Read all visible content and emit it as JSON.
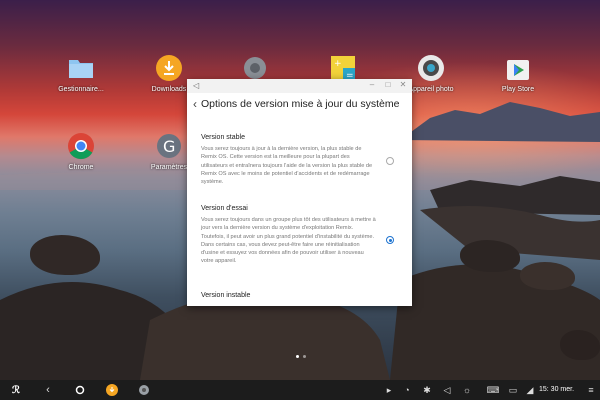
{
  "desktop": {
    "icons": [
      {
        "label": "Gestionnaire...",
        "icon": "folder-icon"
      },
      {
        "label": "Downloads",
        "icon": "download-icon"
      },
      {
        "label": "",
        "icon": "settings-gear-icon"
      },
      {
        "label": "",
        "icon": "calculator-icon"
      },
      {
        "label": "Appareil photo",
        "icon": "camera-icon"
      },
      {
        "label": "Play Store",
        "icon": "play-store-icon"
      },
      {
        "label": "Chrome",
        "icon": "chrome-icon"
      },
      {
        "label": "Paramètres",
        "icon": "google-settings-icon"
      }
    ]
  },
  "dialog": {
    "title": "Options de version mise à jour du système",
    "options": [
      {
        "title": "Version stable",
        "description": "Vous serez toujours à jour à la dernière version, la plus stable de Remix OS. Cette version est la meilleure pour la plupart des utilisateurs et entraînera toujours l'aide de la version la plus stable de Remix OS avec le moins de potentiel d'accidents et de redémarrage système.",
        "selected": false
      },
      {
        "title": "Version d'essai",
        "description": "Vous serez toujours dans un groupe plus tôt des utilisateurs à mettre à jour vers la dernière version du système d'exploitation Remix. Toutefois, il peut avoir un plus grand potentiel d'instabilité du système. Dans certains cas, vous devez peut-être faire une réinitialisation d'usine et essuyez vos données afin de pouvoir utiliser à nouveau votre appareil.",
        "selected": true
      },
      {
        "title": "Version instable",
        "description": "",
        "selected": false
      }
    ]
  },
  "taskbar": {
    "clock": "15: 30 mer."
  },
  "colors": {
    "accent": "#1e73d0",
    "taskbar": "#1c1c1c"
  }
}
